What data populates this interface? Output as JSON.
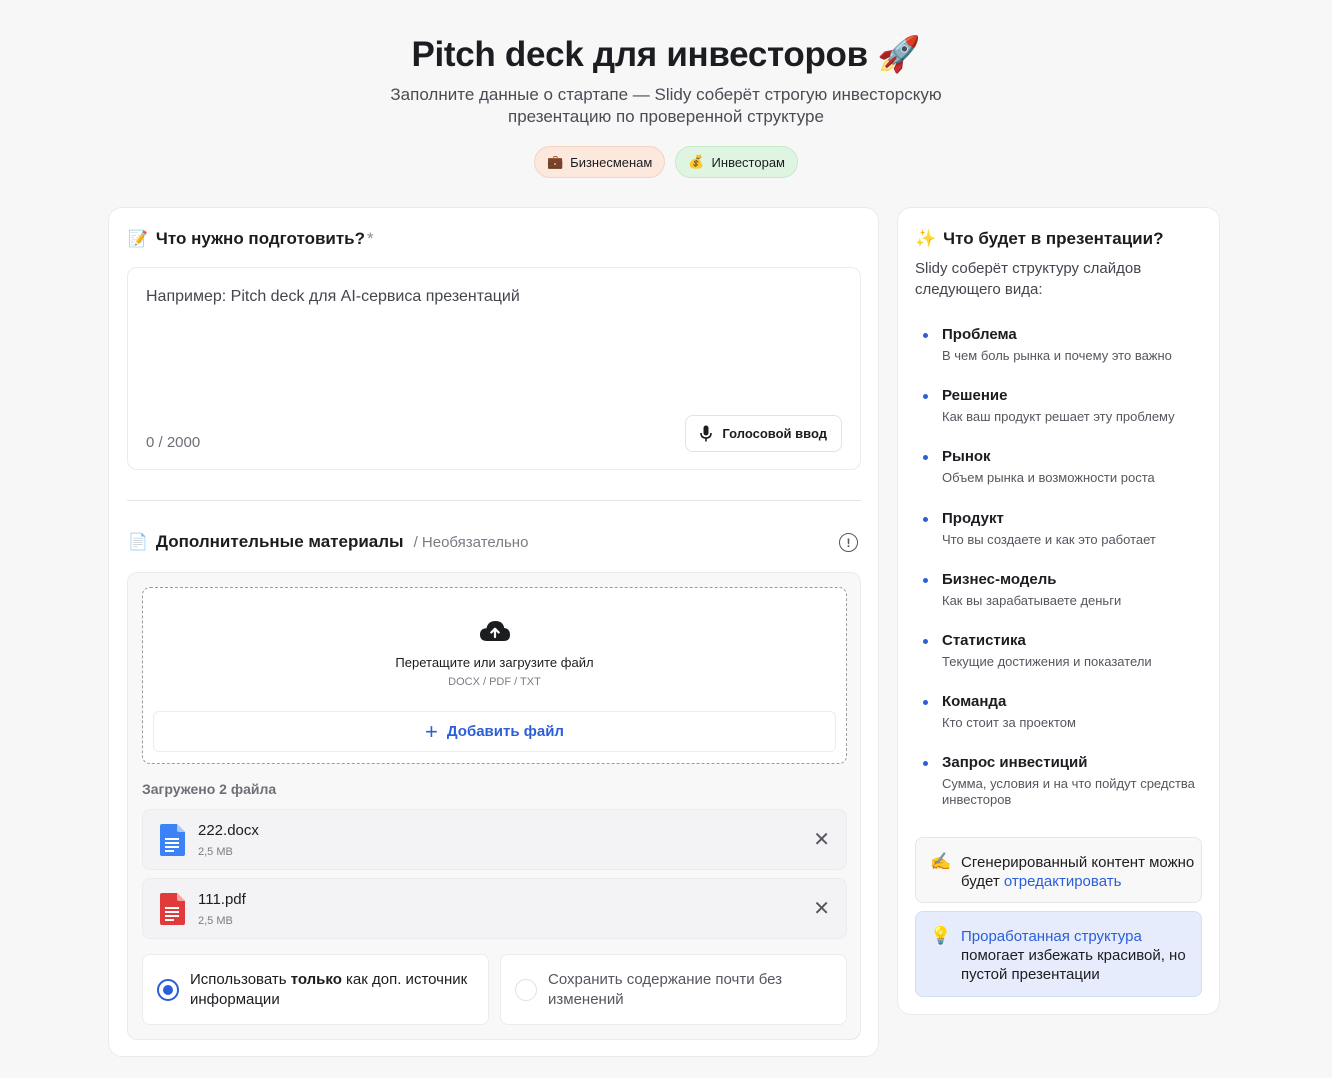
{
  "header": {
    "title": "Pitch deck для инвесторов",
    "title_icon": "rocket-icon",
    "subtitle_line1": "Заполните данные о стартапе — Slidy соберёт строгую инвесторскую",
    "subtitle_line2": "презентацию по проверенной структуре"
  },
  "chips": [
    {
      "label": "Бизнесменам",
      "icon": "briefcase-icon",
      "color": "#fde8de"
    },
    {
      "label": "Инвесторам",
      "icon": "money-bag-icon",
      "color": "#dff5e2"
    }
  ],
  "prompt_section": {
    "title": "Что нужно подготовить?",
    "required_mark": "*",
    "placeholder": "Например: Pitch deck для AI-сервиса презентаций",
    "counter": "0 / 2000",
    "voice_button": "Голосовой ввод"
  },
  "materials_section": {
    "title": "Дополнительные материалы",
    "optional": "/ Необязательно",
    "drag_text": "Перетащите или загрузите файл",
    "file_types": "DOCX / PDF / TXT",
    "add_button": "Добавить файл",
    "uploaded_label": "Загружено 2 файла",
    "files": [
      {
        "name": "222.docx",
        "size": "2,5 MB",
        "icon": "docx-file-icon"
      },
      {
        "name": "111.pdf",
        "size": "2,5 MB",
        "icon": "pdf-file-icon"
      }
    ],
    "options": [
      {
        "pre": "Использовать ",
        "bold": "только",
        "post": " как доп. источник информации",
        "selected": true
      },
      {
        "text": "Сохранить содержание почти без изменений",
        "selected": false
      }
    ]
  },
  "structure_panel": {
    "title": "Что будет в презентации?",
    "description": "Slidy соберёт структуру слайдов следующего вида:",
    "items": [
      {
        "title": "Проблема",
        "desc": "В чем боль рынка и почему это важно"
      },
      {
        "title": "Решение",
        "desc": "Как ваш продукт решает эту проблему"
      },
      {
        "title": "Рынок",
        "desc": "Объем рынка и возможности роста"
      },
      {
        "title": "Продукт",
        "desc": "Что вы создаете и как это работает"
      },
      {
        "title": "Бизнес-модель",
        "desc": "Как вы зарабатываете деньги"
      },
      {
        "title": "Статистика",
        "desc": "Текущие достижения и показатели"
      },
      {
        "title": "Команда",
        "desc": "Кто стоит за проектом"
      },
      {
        "title": "Запрос инвестиций",
        "desc": "Сумма, условия и на что пойдут средства инвесторов"
      }
    ],
    "note1_pre": "Сгенерированный контент можно будет ",
    "note1_link": "отредактировать",
    "note2_link": "Проработанная структура",
    "note2_post": " помогает избежать красивой, но пустой презентации"
  },
  "colors": {
    "accent": "#2b5fd9",
    "docx": "#3b82f6",
    "pdf": "#e03a3a"
  }
}
